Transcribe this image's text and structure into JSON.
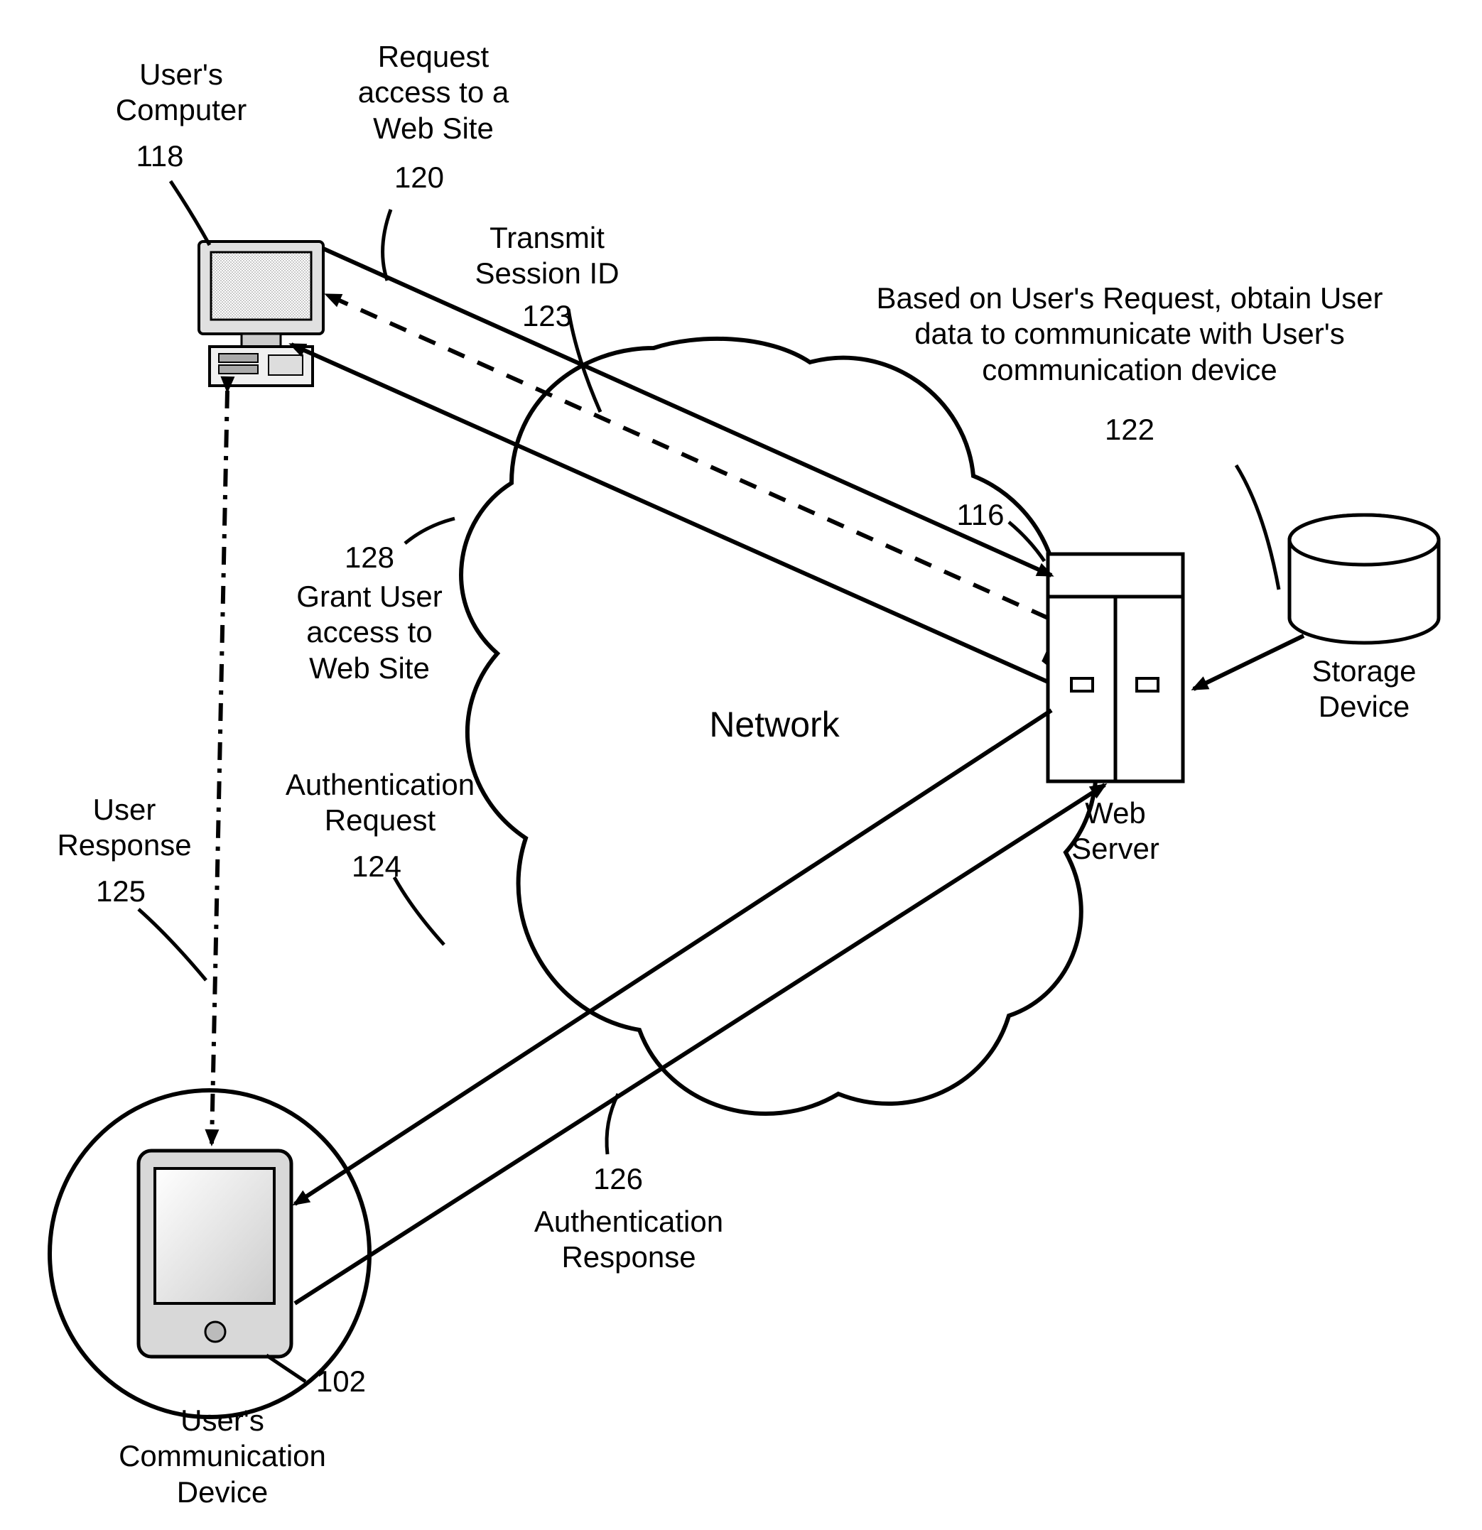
{
  "labels": {
    "computer_title": "User's\nComputer",
    "computer_num": "118",
    "request_title": "Request\naccess to a\nWeb Site",
    "request_num": "120",
    "transmit_title": "Transmit\nSession ID",
    "transmit_num": "123",
    "based_title": "Based on User's Request, obtain User\ndata to communicate with User's\ncommunication device",
    "based_num": "122",
    "webserver_num": "116",
    "webserver_title": "Web\nServer",
    "storage_title": "Storage\nDevice",
    "network_title": "Network",
    "grant_num": "128",
    "grant_title": "Grant User\naccess to\nWeb Site",
    "auth_req_title": "Authentication\nRequest",
    "auth_req_num": "124",
    "user_resp_title": "User\nResponse",
    "user_resp_num": "125",
    "auth_resp_num": "126",
    "auth_resp_title": "Authentication\nResponse",
    "device_num": "102",
    "device_title": "User's\nCommunication\nDevice"
  }
}
